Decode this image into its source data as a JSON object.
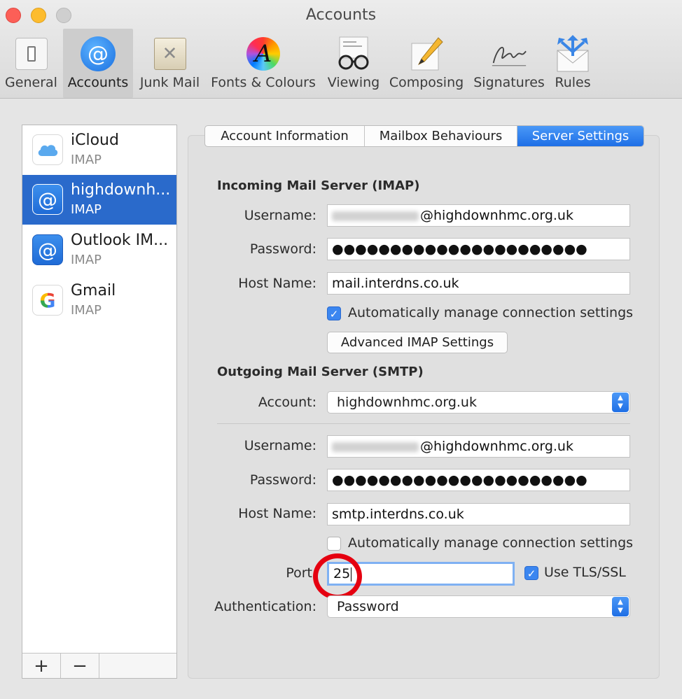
{
  "window": {
    "title": "Accounts"
  },
  "toolbar": [
    {
      "label": "General",
      "icon": "general-switch-icon"
    },
    {
      "label": "Accounts",
      "icon": "at-sign-icon",
      "selected": true
    },
    {
      "label": "Junk Mail",
      "icon": "junk-bin-icon"
    },
    {
      "label": "Fonts & Colours",
      "icon": "font-colour-wheel-icon"
    },
    {
      "label": "Viewing",
      "icon": "glasses-icon"
    },
    {
      "label": "Composing",
      "icon": "pencil-icon"
    },
    {
      "label": "Signatures",
      "icon": "signature-icon"
    },
    {
      "label": "Rules",
      "icon": "envelope-arrows-icon"
    }
  ],
  "accounts": [
    {
      "name": "iCloud",
      "type": "IMAP",
      "icon": "icloud-icon"
    },
    {
      "name": "highdownh...",
      "type": "IMAP",
      "icon": "at-sign-icon",
      "selected": true
    },
    {
      "name": "Outlook IM...",
      "type": "IMAP",
      "icon": "at-sign-icon"
    },
    {
      "name": "Gmail",
      "type": "IMAP",
      "icon": "google-icon",
      "glyph": "G"
    }
  ],
  "list_footer": {
    "add": "+",
    "remove": "−"
  },
  "tabs": [
    {
      "label": "Account Information"
    },
    {
      "label": "Mailbox Behaviours"
    },
    {
      "label": "Server Settings",
      "active": true
    }
  ],
  "incoming": {
    "title": "Incoming Mail Server (IMAP)",
    "username_label": "Username:",
    "username_value": "@highdownhmc.org.uk",
    "password_label": "Password:",
    "password_value": "●●●●●●●●●●●●●●●●●●●●●●",
    "host_label": "Host Name:",
    "host_value": "mail.interdns.co.uk",
    "auto_manage_label": "Automatically manage connection settings",
    "auto_manage_checked": true,
    "advanced_button": "Advanced IMAP Settings"
  },
  "outgoing": {
    "title": "Outgoing Mail Server (SMTP)",
    "account_label": "Account:",
    "account_value": "highdownhmc.org.uk",
    "username_label": "Username:",
    "username_value": "@highdownhmc.org.uk",
    "password_label": "Password:",
    "password_value": "●●●●●●●●●●●●●●●●●●●●●●",
    "host_label": "Host Name:",
    "host_value": "smtp.interdns.co.uk",
    "auto_manage_label": "Automatically manage connection settings",
    "auto_manage_checked": false,
    "port_label": "Port",
    "port_value": "25",
    "tls_label": "Use TLS/SSL",
    "tls_checked": true,
    "auth_label": "Authentication:",
    "auth_value": "Password"
  },
  "colors": {
    "selection_blue": "#2a6acb",
    "tab_active_blue": "#1e6fe6",
    "annotation_red": "#e50010"
  },
  "glyphs": {
    "check": "✓",
    "at": "@",
    "arrow_up": "▲",
    "arrow_down": "▼",
    "close_x": "✕"
  }
}
